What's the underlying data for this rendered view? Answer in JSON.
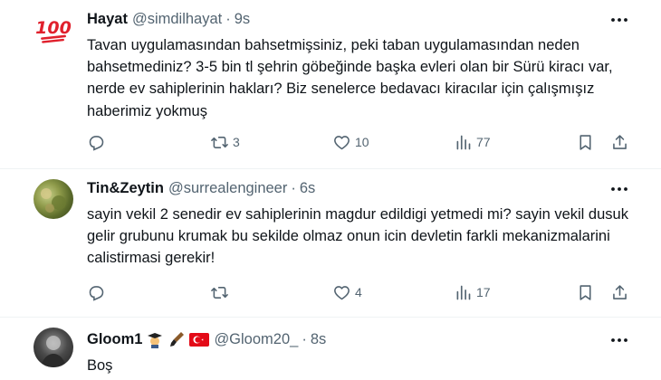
{
  "tweets": [
    {
      "name": "Hayat",
      "handle": "@simdilhayat",
      "time": "9s",
      "text": "Tavan uygulamasından bahsetmişsiniz, peki taban uygulamasından neden bahsetmediniz? 3-5 bin tl şehrin göbeğinde başka evleri olan bir Sürü kiracı var, nerde ev sahiplerinin hakları? Biz senelerce bedavacı kiracılar için çalışmışız haberimiz yokmuş",
      "avatar_icon": "hundred-points-emoji",
      "replies": "",
      "retweets": "3",
      "likes": "10",
      "views": "77"
    },
    {
      "name": "Tin&Zeytin",
      "handle": "@surrealengineer",
      "time": "6s",
      "text": "sayin vekil 2 senedir ev sahiplerinin magdur edildigi yetmedi mi? sayin vekil dusuk gelir grubunu krumak bu sekilde olmaz onun icin devletin farkli mekanizmalarini calistirmasi gerekir!",
      "avatar_icon": "photo-avatar",
      "replies": "",
      "retweets": "",
      "likes": "4",
      "views": "17"
    },
    {
      "name": "Gloom1",
      "handle": "@Gloom20_",
      "time": "8s",
      "text": "Boş",
      "avatar_icon": "photo-avatar",
      "name_emojis": [
        "graduate-emoji",
        "paintbrush-emoji",
        "turkey-flag-emoji"
      ]
    }
  ],
  "colors": {
    "text": "#0f1419",
    "secondary": "#536471",
    "divider": "#eff3f4"
  }
}
